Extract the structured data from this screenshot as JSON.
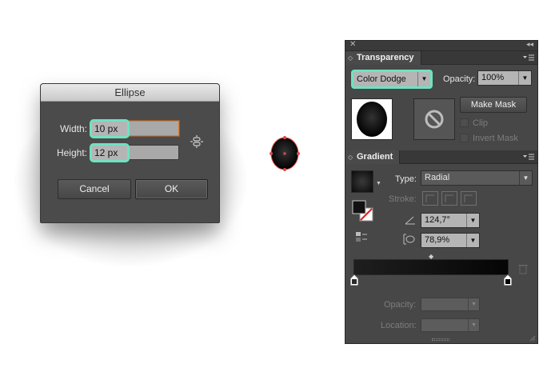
{
  "dialog": {
    "title": "Ellipse",
    "width_label": "Width:",
    "width_value": "10 px",
    "height_label": "Height:",
    "height_value": "12 px",
    "cancel_label": "Cancel",
    "ok_label": "OK"
  },
  "transparency": {
    "tab_label": "Transparency",
    "blend_mode": "Color Dodge",
    "opacity_label": "Opacity:",
    "opacity_value": "100%",
    "make_mask_label": "Make Mask",
    "clip_label": "Clip",
    "invert_mask_label": "Invert Mask"
  },
  "gradient": {
    "tab_label": "Gradient",
    "type_label": "Type:",
    "type_value": "Radial",
    "stroke_label": "Stroke:",
    "angle_value": "124,7°",
    "aspect_value": "78,9%",
    "opacity_label": "Opacity:",
    "location_label": "Location:"
  },
  "colors": {
    "highlight": "#6ee3c0",
    "panel_bg": "#474747",
    "focus": "#e07c2c"
  }
}
